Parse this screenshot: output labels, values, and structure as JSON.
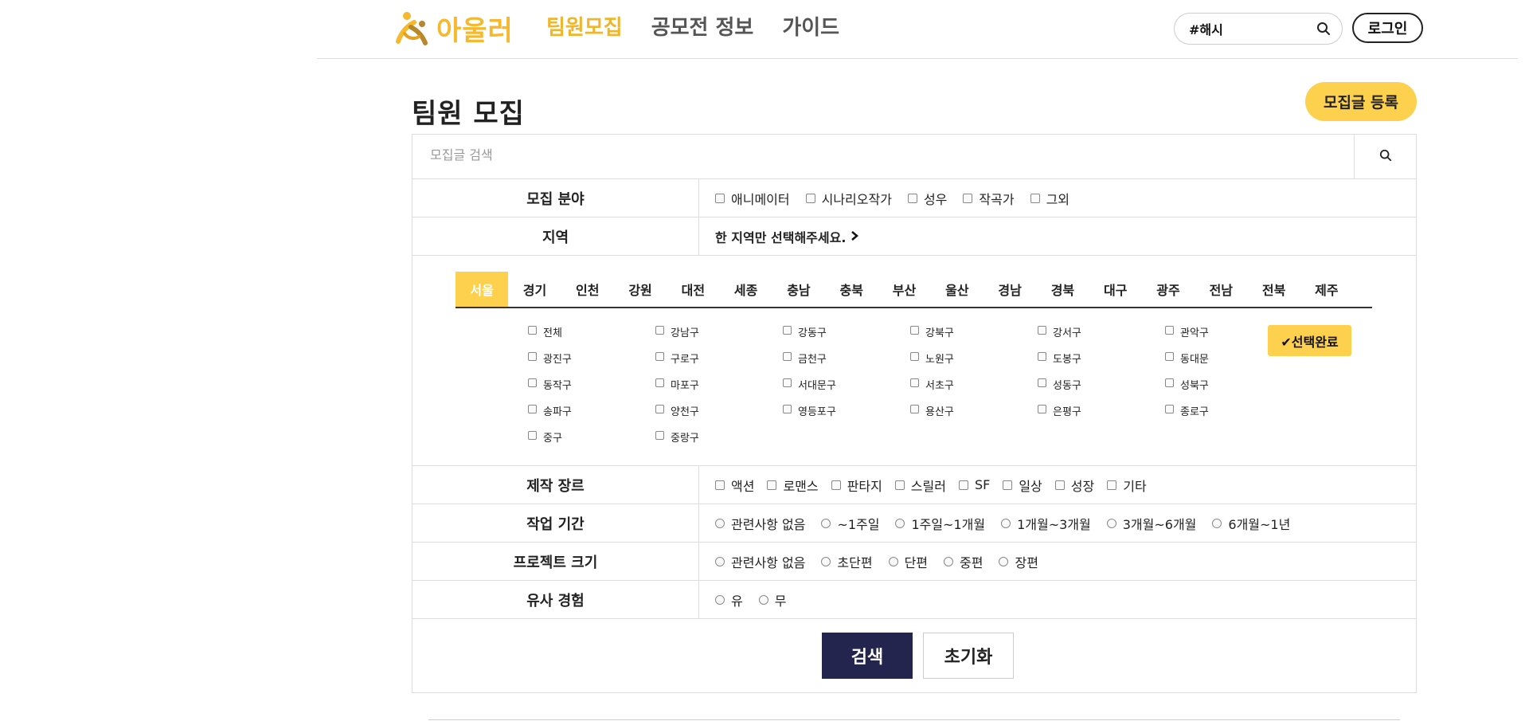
{
  "header": {
    "logo_text": "아울러",
    "brand_color": "#f5b82e",
    "nav": [
      "팀원모집",
      "공모전 정보",
      "가이드"
    ],
    "active_nav_index": 0,
    "search_value": "#해시",
    "login_label": "로그인"
  },
  "page": {
    "title": "팀원 모집",
    "register_label": "모집글 등록",
    "accent_color": "#fdd04e"
  },
  "filters": {
    "post_search_placeholder": "모집글 검색",
    "field": {
      "label": "모집 분야",
      "options": [
        "애니메이터",
        "시나리오작가",
        "성우",
        "작곡가",
        "그외"
      ]
    },
    "region": {
      "label": "지역",
      "hint": "한 지역만 선택해주세요.",
      "tabs": [
        "서울",
        "경기",
        "인천",
        "강원",
        "대전",
        "세종",
        "충남",
        "충북",
        "부산",
        "울산",
        "경남",
        "경북",
        "대구",
        "광주",
        "전남",
        "전북",
        "제주"
      ],
      "active_tab_index": 0,
      "districts": [
        "전체",
        "강남구",
        "강동구",
        "강북구",
        "강서구",
        "관악구",
        "광진구",
        "구로구",
        "금천구",
        "노원구",
        "도봉구",
        "동대문",
        "동작구",
        "마포구",
        "서대문구",
        "서초구",
        "성동구",
        "성북구",
        "송파구",
        "양천구",
        "영등포구",
        "용산구",
        "은평구",
        "종로구",
        "중구",
        "중랑구"
      ],
      "done_label": "선택완료"
    },
    "genre": {
      "label": "제작 장르",
      "options": [
        "액션",
        "로맨스",
        "판타지",
        "스릴러",
        "SF",
        "일상",
        "성장",
        "기타"
      ]
    },
    "period": {
      "label": "작업 기간",
      "options": [
        "관련사항 없음",
        "~1주일",
        "1주일~1개월",
        "1개월~3개월",
        "3개월~6개월",
        "6개월~1년"
      ]
    },
    "size": {
      "label": "프로젝트 크기",
      "options": [
        "관련사항 없음",
        "초단편",
        "단편",
        "중편",
        "장편"
      ]
    },
    "experience": {
      "label": "유사 경험",
      "options": [
        "유",
        "무"
      ]
    },
    "search_label": "검색",
    "reset_label": "초기화",
    "search_button_color": "#24254f"
  }
}
